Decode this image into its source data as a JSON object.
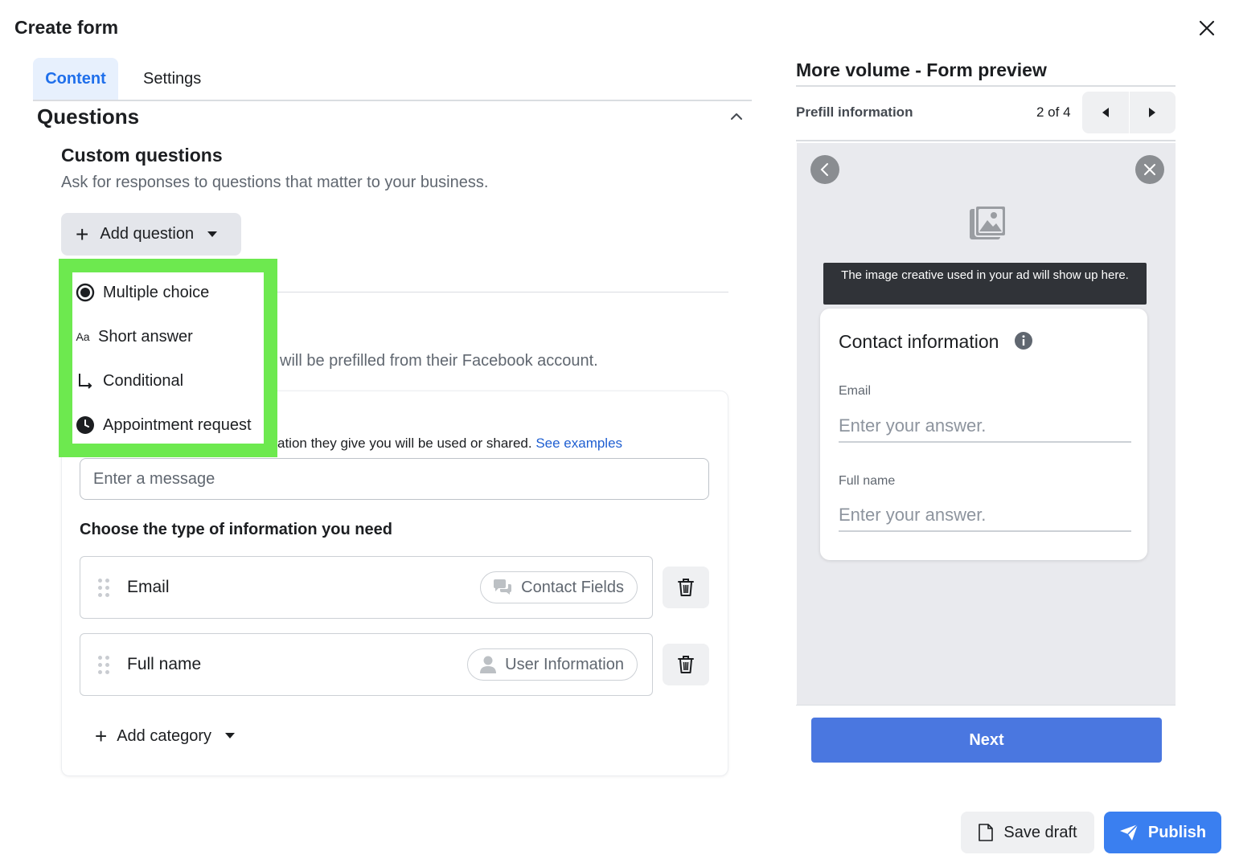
{
  "header": {
    "title": "Create form"
  },
  "tabs": [
    {
      "label": "Content",
      "active": true
    },
    {
      "label": "Settings",
      "active": false
    }
  ],
  "questions": {
    "title": "Questions",
    "custom_title": "Custom questions",
    "custom_desc": "Ask for responses to questions that matter to your business.",
    "add_question_label": "Add question"
  },
  "dropdown": {
    "items": [
      {
        "label": "Multiple choice",
        "icon": "radio-icon"
      },
      {
        "label": "Short answer",
        "icon": "aa-icon",
        "icon_text": "Aa"
      },
      {
        "label": "Conditional",
        "icon": "branch-arrow-icon"
      },
      {
        "label": "Appointment request",
        "icon": "clock-icon"
      }
    ],
    "highlight_color": "#6de94f"
  },
  "contact": {
    "prefill_note": "will be prefilled from their Facebook account.",
    "privacy_text": "ation they give you will be used or shared.",
    "privacy_link": "See examples",
    "message_placeholder": "Enter a message",
    "choose_title": "Choose the type of information you need",
    "fields": [
      {
        "label": "Email",
        "category": "Contact Fields",
        "category_icon": "chat-bubbles-icon"
      },
      {
        "label": "Full name",
        "category": "User Information",
        "category_icon": "user-icon"
      }
    ],
    "add_category_label": "Add category"
  },
  "preview": {
    "title": "More volume - Form preview",
    "section": "Prefill information",
    "page_count": "2 of 4",
    "creative_text": "The image creative used in your ad will show up here.",
    "contact_heading": "Contact information",
    "email_label": "Email",
    "email_placeholder": "Enter your answer.",
    "name_label": "Full name",
    "name_placeholder": "Enter your answer.",
    "next_label": "Next"
  },
  "footer": {
    "save_draft_label": "Save draft",
    "publish_label": "Publish"
  },
  "colors": {
    "accent": "#1f6feb",
    "next_button": "#4a77e0",
    "publish_button": "#3a7ff0"
  }
}
